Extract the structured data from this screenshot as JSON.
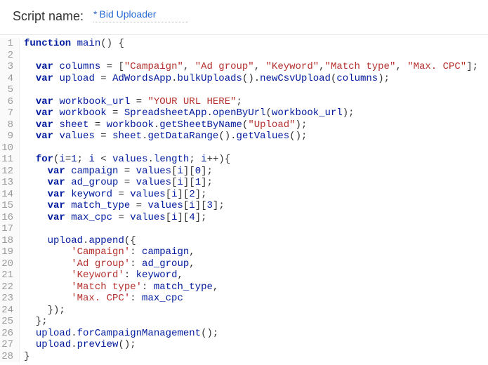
{
  "header": {
    "label": "Script name:",
    "asterisk": "*",
    "script_name": "Bid Uploader"
  },
  "code": {
    "lines": [
      {
        "n": 1,
        "tokens": [
          [
            "kw",
            "function"
          ],
          [
            "plain",
            " "
          ],
          [
            "fn",
            "main"
          ],
          [
            "punct",
            "() {"
          ]
        ]
      },
      {
        "n": 2,
        "tokens": []
      },
      {
        "n": 3,
        "tokens": [
          [
            "plain",
            "  "
          ],
          [
            "kw",
            "var"
          ],
          [
            "plain",
            " "
          ],
          [
            "id",
            "columns"
          ],
          [
            "plain",
            " = ["
          ],
          [
            "str",
            "\"Campaign\""
          ],
          [
            "plain",
            ", "
          ],
          [
            "str",
            "\"Ad group\""
          ],
          [
            "plain",
            ", "
          ],
          [
            "str",
            "\"Keyword\""
          ],
          [
            "plain",
            ","
          ],
          [
            "str",
            "\"Match type\""
          ],
          [
            "plain",
            ", "
          ],
          [
            "str",
            "\"Max. CPC\""
          ],
          [
            "plain",
            "];"
          ]
        ]
      },
      {
        "n": 4,
        "tokens": [
          [
            "plain",
            "  "
          ],
          [
            "kw",
            "var"
          ],
          [
            "plain",
            " "
          ],
          [
            "id",
            "upload"
          ],
          [
            "plain",
            " = "
          ],
          [
            "id",
            "AdWordsApp"
          ],
          [
            "plain",
            "."
          ],
          [
            "id",
            "bulkUploads"
          ],
          [
            "plain",
            "()."
          ],
          [
            "id",
            "newCsvUpload"
          ],
          [
            "plain",
            "("
          ],
          [
            "id",
            "columns"
          ],
          [
            "plain",
            ");"
          ]
        ]
      },
      {
        "n": 5,
        "tokens": []
      },
      {
        "n": 6,
        "tokens": [
          [
            "plain",
            "  "
          ],
          [
            "kw",
            "var"
          ],
          [
            "plain",
            " "
          ],
          [
            "id",
            "workbook_url"
          ],
          [
            "plain",
            " = "
          ],
          [
            "str",
            "\"YOUR URL HERE\""
          ],
          [
            "plain",
            ";"
          ]
        ]
      },
      {
        "n": 7,
        "tokens": [
          [
            "plain",
            "  "
          ],
          [
            "kw",
            "var"
          ],
          [
            "plain",
            " "
          ],
          [
            "id",
            "workbook"
          ],
          [
            "plain",
            " = "
          ],
          [
            "id",
            "SpreadsheetApp"
          ],
          [
            "plain",
            "."
          ],
          [
            "id",
            "openByUrl"
          ],
          [
            "plain",
            "("
          ],
          [
            "id",
            "workbook_url"
          ],
          [
            "plain",
            ");"
          ]
        ]
      },
      {
        "n": 8,
        "tokens": [
          [
            "plain",
            "  "
          ],
          [
            "kw",
            "var"
          ],
          [
            "plain",
            " "
          ],
          [
            "id",
            "sheet"
          ],
          [
            "plain",
            " = "
          ],
          [
            "id",
            "workbook"
          ],
          [
            "plain",
            "."
          ],
          [
            "id",
            "getSheetByName"
          ],
          [
            "plain",
            "("
          ],
          [
            "str",
            "\"Upload\""
          ],
          [
            "plain",
            ");"
          ]
        ]
      },
      {
        "n": 9,
        "tokens": [
          [
            "plain",
            "  "
          ],
          [
            "kw",
            "var"
          ],
          [
            "plain",
            " "
          ],
          [
            "id",
            "values"
          ],
          [
            "plain",
            " = "
          ],
          [
            "id",
            "sheet"
          ],
          [
            "plain",
            "."
          ],
          [
            "id",
            "getDataRange"
          ],
          [
            "plain",
            "()."
          ],
          [
            "id",
            "getValues"
          ],
          [
            "plain",
            "();"
          ]
        ]
      },
      {
        "n": 10,
        "tokens": []
      },
      {
        "n": 11,
        "tokens": [
          [
            "plain",
            "  "
          ],
          [
            "kw",
            "for"
          ],
          [
            "plain",
            "("
          ],
          [
            "id",
            "i"
          ],
          [
            "plain",
            "="
          ],
          [
            "num",
            "1"
          ],
          [
            "plain",
            "; "
          ],
          [
            "id",
            "i"
          ],
          [
            "plain",
            " < "
          ],
          [
            "id",
            "values"
          ],
          [
            "plain",
            "."
          ],
          [
            "id",
            "length"
          ],
          [
            "plain",
            "; "
          ],
          [
            "id",
            "i"
          ],
          [
            "plain",
            "++){"
          ]
        ]
      },
      {
        "n": 12,
        "tokens": [
          [
            "plain",
            "    "
          ],
          [
            "kw",
            "var"
          ],
          [
            "plain",
            " "
          ],
          [
            "id",
            "campaign"
          ],
          [
            "plain",
            " = "
          ],
          [
            "id",
            "values"
          ],
          [
            "plain",
            "["
          ],
          [
            "id",
            "i"
          ],
          [
            "plain",
            "]["
          ],
          [
            "num",
            "0"
          ],
          [
            "plain",
            "];"
          ]
        ]
      },
      {
        "n": 13,
        "tokens": [
          [
            "plain",
            "    "
          ],
          [
            "kw",
            "var"
          ],
          [
            "plain",
            " "
          ],
          [
            "id",
            "ad_group"
          ],
          [
            "plain",
            " = "
          ],
          [
            "id",
            "values"
          ],
          [
            "plain",
            "["
          ],
          [
            "id",
            "i"
          ],
          [
            "plain",
            "]["
          ],
          [
            "num",
            "1"
          ],
          [
            "plain",
            "];"
          ]
        ]
      },
      {
        "n": 14,
        "tokens": [
          [
            "plain",
            "    "
          ],
          [
            "kw",
            "var"
          ],
          [
            "plain",
            " "
          ],
          [
            "id",
            "keyword"
          ],
          [
            "plain",
            " = "
          ],
          [
            "id",
            "values"
          ],
          [
            "plain",
            "["
          ],
          [
            "id",
            "i"
          ],
          [
            "plain",
            "]["
          ],
          [
            "num",
            "2"
          ],
          [
            "plain",
            "];"
          ]
        ]
      },
      {
        "n": 15,
        "tokens": [
          [
            "plain",
            "    "
          ],
          [
            "kw",
            "var"
          ],
          [
            "plain",
            " "
          ],
          [
            "id",
            "match_type"
          ],
          [
            "plain",
            " = "
          ],
          [
            "id",
            "values"
          ],
          [
            "plain",
            "["
          ],
          [
            "id",
            "i"
          ],
          [
            "plain",
            "]["
          ],
          [
            "num",
            "3"
          ],
          [
            "plain",
            "];"
          ]
        ]
      },
      {
        "n": 16,
        "tokens": [
          [
            "plain",
            "    "
          ],
          [
            "kw",
            "var"
          ],
          [
            "plain",
            " "
          ],
          [
            "id",
            "max_cpc"
          ],
          [
            "plain",
            " = "
          ],
          [
            "id",
            "values"
          ],
          [
            "plain",
            "["
          ],
          [
            "id",
            "i"
          ],
          [
            "plain",
            "]["
          ],
          [
            "num",
            "4"
          ],
          [
            "plain",
            "];"
          ]
        ]
      },
      {
        "n": 17,
        "tokens": []
      },
      {
        "n": 18,
        "tokens": [
          [
            "plain",
            "    "
          ],
          [
            "id",
            "upload"
          ],
          [
            "plain",
            "."
          ],
          [
            "id",
            "append"
          ],
          [
            "plain",
            "({"
          ]
        ]
      },
      {
        "n": 19,
        "tokens": [
          [
            "plain",
            "        "
          ],
          [
            "str",
            "'Campaign'"
          ],
          [
            "plain",
            ": "
          ],
          [
            "id",
            "campaign"
          ],
          [
            "plain",
            ","
          ]
        ]
      },
      {
        "n": 20,
        "tokens": [
          [
            "plain",
            "        "
          ],
          [
            "str",
            "'Ad group'"
          ],
          [
            "plain",
            ": "
          ],
          [
            "id",
            "ad_group"
          ],
          [
            "plain",
            ","
          ]
        ]
      },
      {
        "n": 21,
        "tokens": [
          [
            "plain",
            "        "
          ],
          [
            "str",
            "'Keyword'"
          ],
          [
            "plain",
            ": "
          ],
          [
            "id",
            "keyword"
          ],
          [
            "plain",
            ","
          ]
        ]
      },
      {
        "n": 22,
        "tokens": [
          [
            "plain",
            "        "
          ],
          [
            "str",
            "'Match type'"
          ],
          [
            "plain",
            ": "
          ],
          [
            "id",
            "match_type"
          ],
          [
            "plain",
            ","
          ]
        ]
      },
      {
        "n": 23,
        "tokens": [
          [
            "plain",
            "        "
          ],
          [
            "str",
            "'Max. CPC'"
          ],
          [
            "plain",
            ": "
          ],
          [
            "id",
            "max_cpc"
          ]
        ]
      },
      {
        "n": 24,
        "tokens": [
          [
            "plain",
            "    });"
          ]
        ]
      },
      {
        "n": 25,
        "tokens": [
          [
            "plain",
            "  };"
          ]
        ]
      },
      {
        "n": 26,
        "tokens": [
          [
            "plain",
            "  "
          ],
          [
            "id",
            "upload"
          ],
          [
            "plain",
            "."
          ],
          [
            "id",
            "forCampaignManagement"
          ],
          [
            "plain",
            "();"
          ]
        ]
      },
      {
        "n": 27,
        "tokens": [
          [
            "plain",
            "  "
          ],
          [
            "id",
            "upload"
          ],
          [
            "plain",
            "."
          ],
          [
            "id",
            "preview"
          ],
          [
            "plain",
            "();"
          ]
        ]
      },
      {
        "n": 28,
        "tokens": [
          [
            "plain",
            "}"
          ]
        ]
      }
    ]
  }
}
